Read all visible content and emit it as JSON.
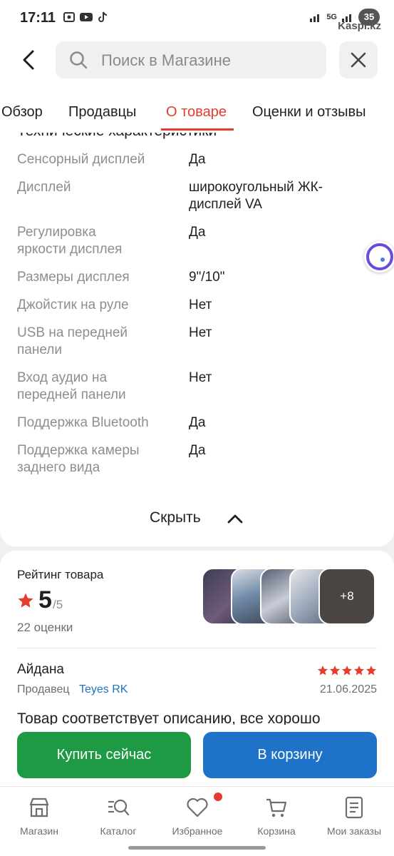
{
  "status_bar": {
    "time": "17:11",
    "network": "5G",
    "battery": "35",
    "watermark": "Kaspi.kz"
  },
  "header": {
    "search_placeholder": "Поиск в Магазине"
  },
  "tabs": [
    {
      "label": "Обзор"
    },
    {
      "label": "Продавцы"
    },
    {
      "label": "О товаре"
    },
    {
      "label": "Оценки и отзывы"
    }
  ],
  "specs": {
    "cut_heading": "Технические характеристики",
    "rows": [
      {
        "label": "Сенсорный дисплей",
        "value": "Да"
      },
      {
        "label": "Дисплей",
        "value": "широкоугольный ЖК-дисплей VA"
      },
      {
        "label": "Регулировка яркости дисплея",
        "value": "Да"
      },
      {
        "label": "Размеры дисплея",
        "value": "9\"/10\""
      },
      {
        "label": "Джойстик на руле",
        "value": "Нет"
      },
      {
        "label": "USB на передней панели",
        "value": "Нет"
      },
      {
        "label": "Вход аудио на передней панели",
        "value": "Нет"
      },
      {
        "label": "Поддержка Bluetooth",
        "value": "Да"
      },
      {
        "label": "Поддержка камеры заднего вида",
        "value": "Да"
      }
    ],
    "hide_label": "Скрыть"
  },
  "rating": {
    "title": "Рейтинг товара",
    "value": "5",
    "max": "/5",
    "count": "22 оценки",
    "more_photos": "+8"
  },
  "review": {
    "author": "Айдана",
    "stars": 5,
    "seller_prefix": "Продавец",
    "seller_name": "Teyes RK",
    "date": "21.06.2025",
    "text": "Товар соответствует описанию, все хорошо"
  },
  "actions": {
    "buy_now": "Купить сейчас",
    "add_to_cart": "В корзину"
  },
  "bottom_nav": [
    {
      "label": "Магазин",
      "icon": "store-icon"
    },
    {
      "label": "Каталог",
      "icon": "catalog-search-icon"
    },
    {
      "label": "Избранное",
      "icon": "heart-icon"
    },
    {
      "label": "Корзина",
      "icon": "cart-icon"
    },
    {
      "label": "Мои заказы",
      "icon": "orders-icon"
    }
  ],
  "colors": {
    "accent": "#e43d2e",
    "buy_green": "#1d9a43",
    "cart_blue": "#1e73c8",
    "seller_link": "#1e73be"
  }
}
